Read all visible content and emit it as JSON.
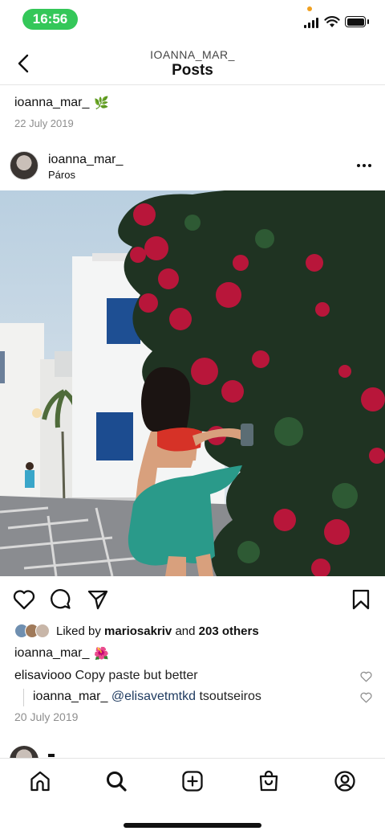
{
  "status_bar": {
    "time": "16:56",
    "colors": {
      "time_pill": "#34c759",
      "privacy_dot": "#f0a020"
    },
    "icons": [
      "signal-icon",
      "wifi-icon",
      "battery-icon"
    ]
  },
  "header": {
    "username": "IOANNA_MAR_",
    "title": "Posts",
    "icons": [
      "back-arrow-icon"
    ]
  },
  "previous_post": {
    "caption_user": "ioanna_mar_",
    "caption_emoji": "🌿",
    "date": "22 July 2019"
  },
  "post": {
    "username": "ioanna_mar_",
    "location": "Páros",
    "icons": [
      "more-options-icon",
      "heart-icon",
      "comment-icon",
      "share-icon",
      "bookmark-icon"
    ],
    "likes": {
      "prefix": "Liked by",
      "user": "mariosakriv",
      "connector": "and",
      "others": "203 others"
    },
    "caption_user": "ioanna_mar_",
    "caption_emoji": "🌺",
    "comments": [
      {
        "user": "elisaviooo",
        "text": "Copy paste but better"
      },
      {
        "user": "ioanna_mar_",
        "mention": "@elisavetmtkd",
        "text": "tsoutseiros"
      }
    ],
    "date": "20 July 2019"
  },
  "bottom_nav": {
    "items": [
      "home-icon",
      "search-icon",
      "add-post-icon",
      "shop-icon",
      "profile-icon"
    ]
  }
}
